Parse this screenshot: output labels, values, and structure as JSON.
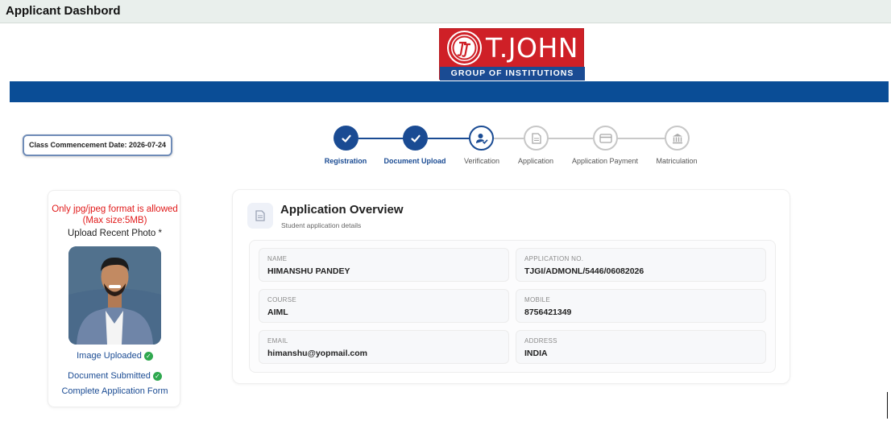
{
  "window": {
    "title": "Applicant Dashbord"
  },
  "logo": {
    "brand": "T.JOHN",
    "tagline": "GROUP OF INSTITUTIONS"
  },
  "class_commencement": {
    "text": "Class Commencement Date: 2026-07-24"
  },
  "stepper": {
    "steps": [
      {
        "label": "Registration",
        "state": "done",
        "icon": "check-icon"
      },
      {
        "label": "Document Upload",
        "state": "done",
        "icon": "check-icon"
      },
      {
        "label": "Verification",
        "state": "current",
        "icon": "user-check-icon"
      },
      {
        "label": "Application",
        "state": "pending",
        "icon": "document-icon"
      },
      {
        "label": "Application Payment",
        "state": "pending",
        "icon": "credit-card-icon"
      },
      {
        "label": "Matriculation",
        "state": "pending",
        "icon": "institution-icon"
      }
    ]
  },
  "photo_panel": {
    "note": "Only jpg/jpeg format is allowed (Max size:5MB)",
    "upload_label": "Upload Recent Photo *",
    "status": [
      {
        "label": "Image Uploaded",
        "check": true
      },
      {
        "label": "Document Submitted",
        "check": true
      },
      {
        "label": "Complete Application Form",
        "check": false
      }
    ]
  },
  "overview": {
    "title": "Application Overview",
    "subtitle": "Student application details",
    "fields": [
      {
        "label": "NAME",
        "value": "HIMANSHU PANDEY"
      },
      {
        "label": "APPLICATION NO.",
        "value": "TJGI/ADMONL/5446/06082026"
      },
      {
        "label": "COURSE",
        "value": "AIML"
      },
      {
        "label": "MOBILE",
        "value": "8756421349"
      },
      {
        "label": "EMAIL",
        "value": "himanshu@yopmail.com"
      },
      {
        "label": "ADDRESS",
        "value": "INDIA"
      }
    ]
  },
  "colors": {
    "primary": "#1a4b93",
    "brand_red": "#cf2027",
    "success": "#2fa84f",
    "warning_text": "#e11b1b"
  }
}
